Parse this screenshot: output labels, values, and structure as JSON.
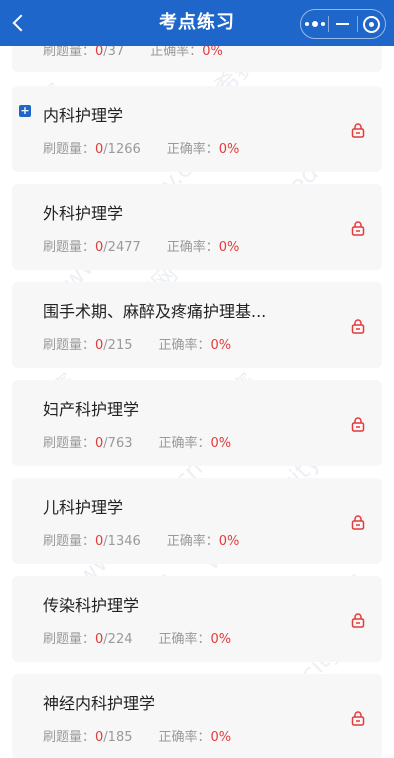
{
  "header": {
    "title": "考点练习",
    "back_icon": "chevron-left-icon",
    "menu_icons": [
      "more-dots-icon",
      "minimize-icon",
      "close-target-icon"
    ],
    "bg_color": "#1e66c9"
  },
  "stats_labels": {
    "count": "刷题量：",
    "accuracy": "正确率："
  },
  "colors": {
    "highlight": "#e23b3b",
    "card_bg": "#f7f7f7"
  },
  "cards": [
    {
      "name": "",
      "done": "0",
      "total": "/37",
      "accuracy": "0%",
      "partial": true
    },
    {
      "name": "内科护理学",
      "done": "0",
      "total": "/1266",
      "accuracy": "0%",
      "expand": "+"
    },
    {
      "name": "外科护理学",
      "done": "0",
      "total": "/2477",
      "accuracy": "0%"
    },
    {
      "name": "围手术期、麻醉及疼痛护理基...",
      "done": "0",
      "total": "/215",
      "accuracy": "0%"
    },
    {
      "name": "妇产科护理学",
      "done": "0",
      "total": "/763",
      "accuracy": "0%"
    },
    {
      "name": "儿科护理学",
      "done": "0",
      "total": "/1346",
      "accuracy": "0%"
    },
    {
      "name": "传染科护理学",
      "done": "0",
      "total": "/224",
      "accuracy": "0%"
    },
    {
      "name": "神经内科护理学",
      "done": "0",
      "total": "/185",
      "accuracy": "0%"
    }
  ],
  "watermarks": [
    "希赛",
    "www.educity.cn",
    "希赛网"
  ]
}
